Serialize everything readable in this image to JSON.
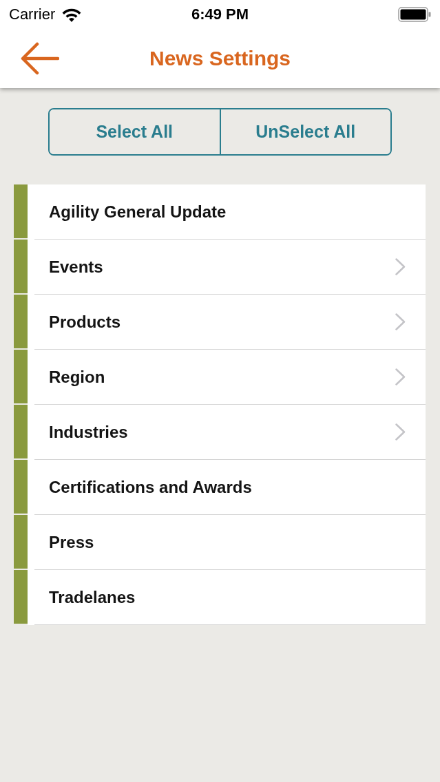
{
  "status_bar": {
    "carrier": "Carrier",
    "time": "6:49 PM"
  },
  "nav_bar": {
    "title": "News Settings"
  },
  "segmented_control": {
    "buttons": [
      {
        "label": "Select All"
      },
      {
        "label": "UnSelect All"
      }
    ]
  },
  "categories": [
    {
      "label": "Agility General Update",
      "selected": true,
      "kind": "plain"
    },
    {
      "label": "Events",
      "selected": true,
      "kind": "submenu"
    },
    {
      "label": "Products",
      "selected": true,
      "kind": "submenu"
    },
    {
      "label": "Region",
      "selected": true,
      "kind": "submenu"
    },
    {
      "label": "Industries",
      "selected": true,
      "kind": "submenu"
    },
    {
      "label": "Certifications and Awards",
      "selected": true,
      "kind": "plain"
    },
    {
      "label": "Press",
      "selected": true,
      "kind": "plain"
    },
    {
      "label": "Tradelanes",
      "selected": true,
      "kind": "plain"
    }
  ]
}
